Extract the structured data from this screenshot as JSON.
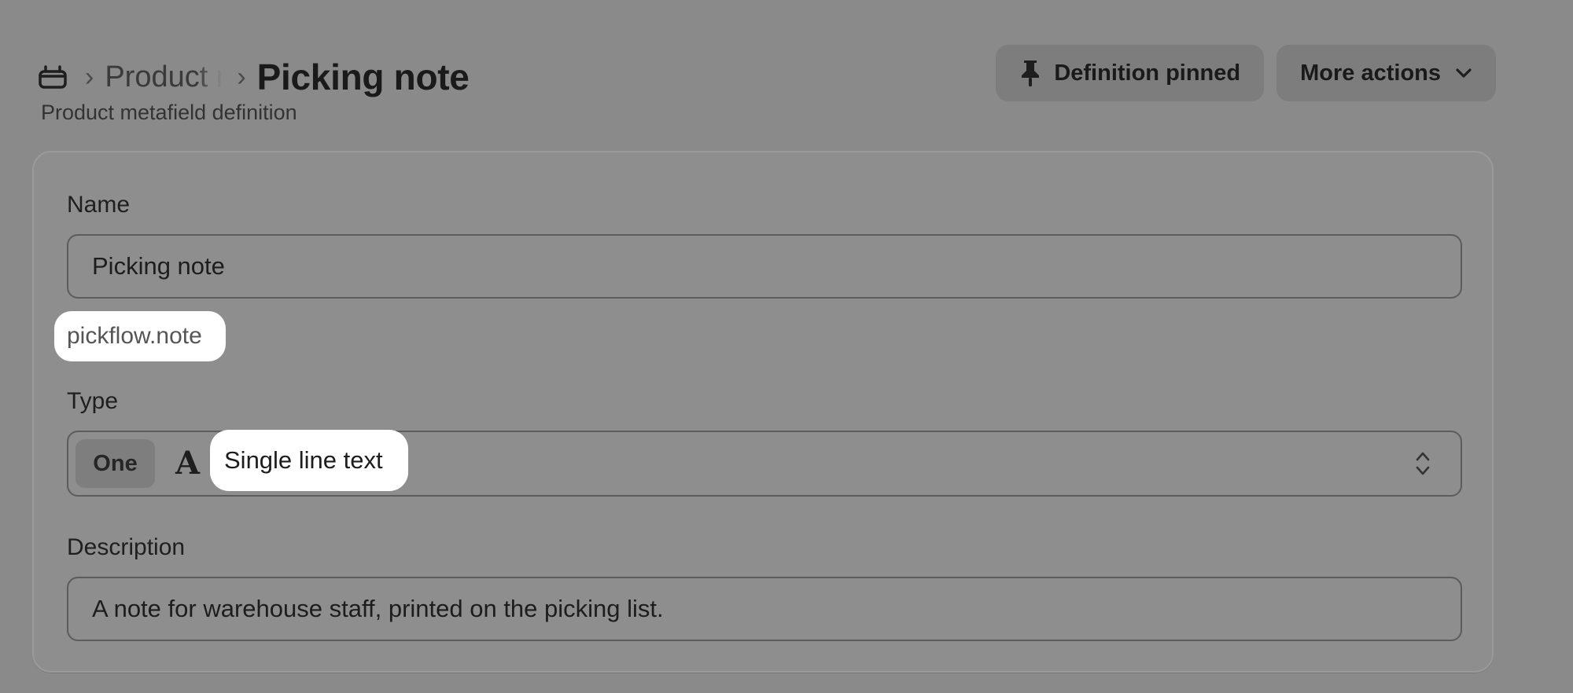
{
  "header": {
    "home_icon": "store-icon",
    "breadcrumb_parent": "Product metafields",
    "title": "Picking note",
    "subtitle": "Product metafield definition",
    "pinned_label": "Definition pinned",
    "pinned_icon": "pin-icon",
    "more_actions_label": "More actions",
    "more_actions_icon": "chevron-down-icon"
  },
  "form": {
    "name_label": "Name",
    "name_value": "Picking note",
    "namespace_key": "pickflow.note",
    "type_label": "Type",
    "type_list_badge": "One",
    "type_icon": "text-type-icon",
    "type_value": "Single line text",
    "type_select_icon": "select-updown-icon",
    "description_label": "Description",
    "description_value": "A note for warehouse staff, printed on the picking list."
  },
  "colors": {
    "overlay_background": "#8a8a8a",
    "highlight": "#ffffff"
  }
}
